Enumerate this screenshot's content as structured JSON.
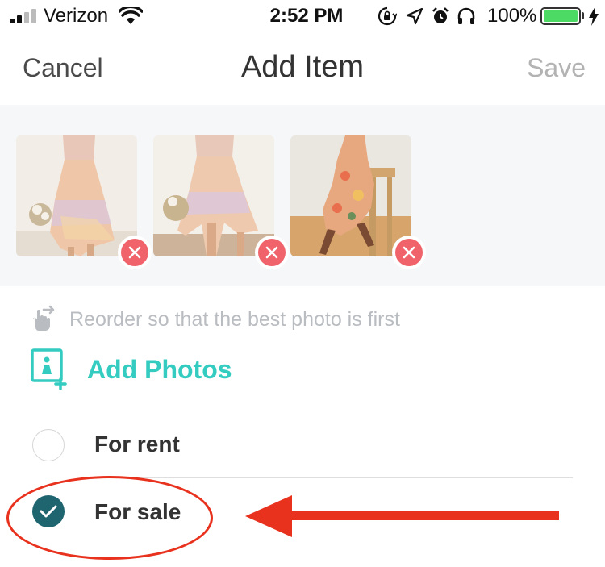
{
  "status_bar": {
    "carrier": "Verizon",
    "time": "2:52 PM",
    "battery_percent": "100%",
    "battery_level": 1.0,
    "icons": [
      "signal-icon",
      "wifi-icon",
      "orientation-lock-icon",
      "location-icon",
      "alarm-icon",
      "headphones-icon",
      "battery-icon",
      "charging-icon"
    ]
  },
  "nav": {
    "cancel_label": "Cancel",
    "title": "Add Item",
    "save_label": "Save"
  },
  "photos": {
    "items": [
      {
        "name": "photo-1",
        "remove_icon": "close-icon"
      },
      {
        "name": "photo-2",
        "remove_icon": "close-icon"
      },
      {
        "name": "photo-3",
        "remove_icon": "close-icon"
      }
    ]
  },
  "reorder_hint": {
    "icon": "drag-hand-icon",
    "text": "Reorder so that the best photo is first"
  },
  "add_photos": {
    "icon": "add-photo-icon",
    "label": "Add Photos"
  },
  "listing_type": {
    "options": [
      {
        "label": "For rent",
        "selected": false
      },
      {
        "label": "For sale",
        "selected": true
      }
    ]
  },
  "colors": {
    "accent_teal": "#34ccc0",
    "selected_radio": "#1f6570",
    "remove_red": "#f0636b",
    "annotation_red": "#e8321e",
    "battery_green": "#4cd964"
  }
}
